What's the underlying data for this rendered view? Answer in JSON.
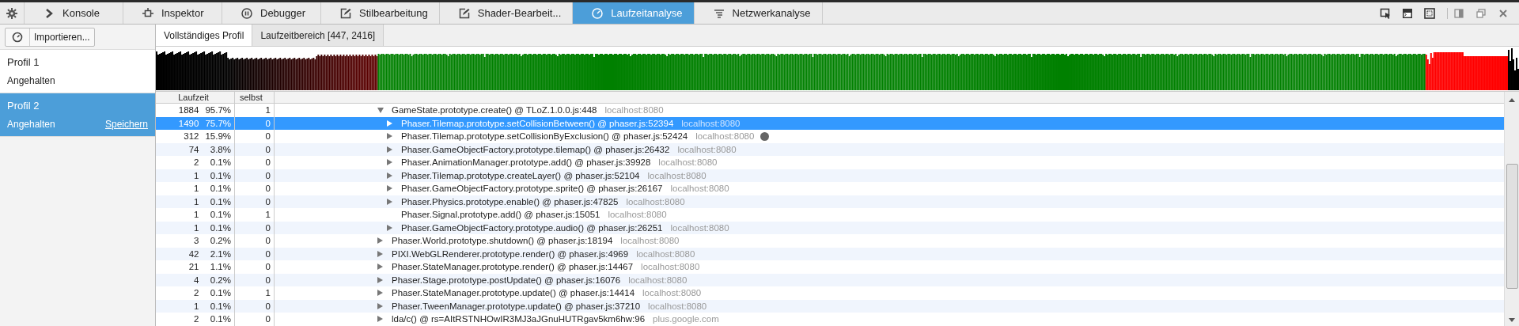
{
  "toolbar": {
    "tabs": [
      {
        "label": "Konsole",
        "selected": false
      },
      {
        "label": "Inspektor",
        "selected": false
      },
      {
        "label": "Debugger",
        "selected": false
      },
      {
        "label": "Stilbearbeitung",
        "selected": false
      },
      {
        "label": "Shader-Bearbeit...",
        "selected": false
      },
      {
        "label": "Laufzeitanalyse",
        "selected": true
      },
      {
        "label": "Netzwerkanalyse",
        "selected": false
      }
    ]
  },
  "sidebar": {
    "import_button": "Importieren...",
    "profiles": [
      {
        "name": "Profil 1",
        "status": "Angehalten",
        "selected": false
      },
      {
        "name": "Profil 2",
        "status": "Angehalten",
        "save_link": "Speichern",
        "selected": true
      }
    ]
  },
  "subtabs": [
    {
      "label": "Vollständiges Profil",
      "selected": true
    },
    {
      "label": "Laufzeitbereich [447, 2416]",
      "selected": false
    }
  ],
  "table": {
    "columns": [
      "Laufzeit",
      "selbst"
    ],
    "rows": [
      {
        "count": "1884",
        "percent": "95.7%",
        "self": "1",
        "name": "GameState.prototype.create() @ TLoZ.1.0.0.js:448",
        "host": "localhost:8080",
        "expanded": true,
        "selected": false,
        "children": [
          {
            "count": "1490",
            "percent": "75.7%",
            "self": "0",
            "name": "Phaser.Tilemap.prototype.setCollisionBetween() @ phaser.js:52394",
            "host": "localhost:8080",
            "expanded": false,
            "selected": true
          },
          {
            "count": "312",
            "percent": "15.9%",
            "self": "0",
            "name": "Phaser.Tilemap.prototype.setCollisionByExclusion() @ phaser.js:52424",
            "host": "localhost:8080",
            "expanded": false,
            "selected": false,
            "hovered": true
          },
          {
            "count": "74",
            "percent": "3.8%",
            "self": "0",
            "name": "Phaser.GameObjectFactory.prototype.tilemap() @ phaser.js:26432",
            "host": "localhost:8080",
            "expanded": false,
            "selected": false
          },
          {
            "count": "2",
            "percent": "0.1%",
            "self": "0",
            "name": "Phaser.AnimationManager.prototype.add() @ phaser.js:39928",
            "host": "localhost:8080",
            "expanded": false,
            "selected": false
          },
          {
            "count": "1",
            "percent": "0.1%",
            "self": "0",
            "name": "Phaser.Tilemap.prototype.createLayer() @ phaser.js:52104",
            "host": "localhost:8080",
            "expanded": false,
            "selected": false
          },
          {
            "count": "1",
            "percent": "0.1%",
            "self": "0",
            "name": "Phaser.GameObjectFactory.prototype.sprite() @ phaser.js:26167",
            "host": "localhost:8080",
            "expanded": false,
            "selected": false
          },
          {
            "count": "1",
            "percent": "0.1%",
            "self": "0",
            "name": "Phaser.Physics.prototype.enable() @ phaser.js:47825",
            "host": "localhost:8080",
            "expanded": false,
            "selected": false
          },
          {
            "kind": "leaf",
            "count": "1",
            "percent": "0.1%",
            "self": "1",
            "name": "Phaser.Signal.prototype.add() @ phaser.js:15051",
            "host": "localhost:8080",
            "selected": false
          },
          {
            "count": "1",
            "percent": "0.1%",
            "self": "0",
            "name": "Phaser.GameObjectFactory.prototype.audio() @ phaser.js:26251",
            "host": "localhost:8080",
            "expanded": false,
            "selected": false
          }
        ]
      },
      {
        "count": "3",
        "percent": "0.2%",
        "self": "0",
        "name": "Phaser.World.prototype.shutdown() @ phaser.js:18194",
        "host": "localhost:8080",
        "expanded": false,
        "selected": false
      },
      {
        "count": "42",
        "percent": "2.1%",
        "self": "0",
        "name": "PIXI.WebGLRenderer.prototype.render() @ phaser.js:4969",
        "host": "localhost:8080",
        "expanded": false,
        "selected": false
      },
      {
        "count": "21",
        "percent": "1.1%",
        "self": "0",
        "name": "Phaser.StateManager.prototype.render() @ phaser.js:14467",
        "host": "localhost:8080",
        "expanded": false,
        "selected": false
      },
      {
        "count": "4",
        "percent": "0.2%",
        "self": "0",
        "name": "Phaser.Stage.prototype.postUpdate() @ phaser.js:16076",
        "host": "localhost:8080",
        "expanded": false,
        "selected": false
      },
      {
        "count": "2",
        "percent": "0.1%",
        "self": "1",
        "name": "Phaser.StateManager.prototype.update() @ phaser.js:14414",
        "host": "localhost:8080",
        "expanded": false,
        "selected": false
      },
      {
        "count": "1",
        "percent": "0.1%",
        "self": "0",
        "name": "Phaser.TweenManager.prototype.update() @ phaser.js:37210",
        "host": "localhost:8080",
        "expanded": false,
        "selected": false
      },
      {
        "count": "2",
        "percent": "0.1%",
        "self": "0",
        "name": "lda/c() @ rs=AItRSTNHOwIR3MJ3aJGnuHUTRgav5km6hw:96",
        "host": "plus.google.com",
        "expanded": false,
        "selected": false
      }
    ]
  }
}
